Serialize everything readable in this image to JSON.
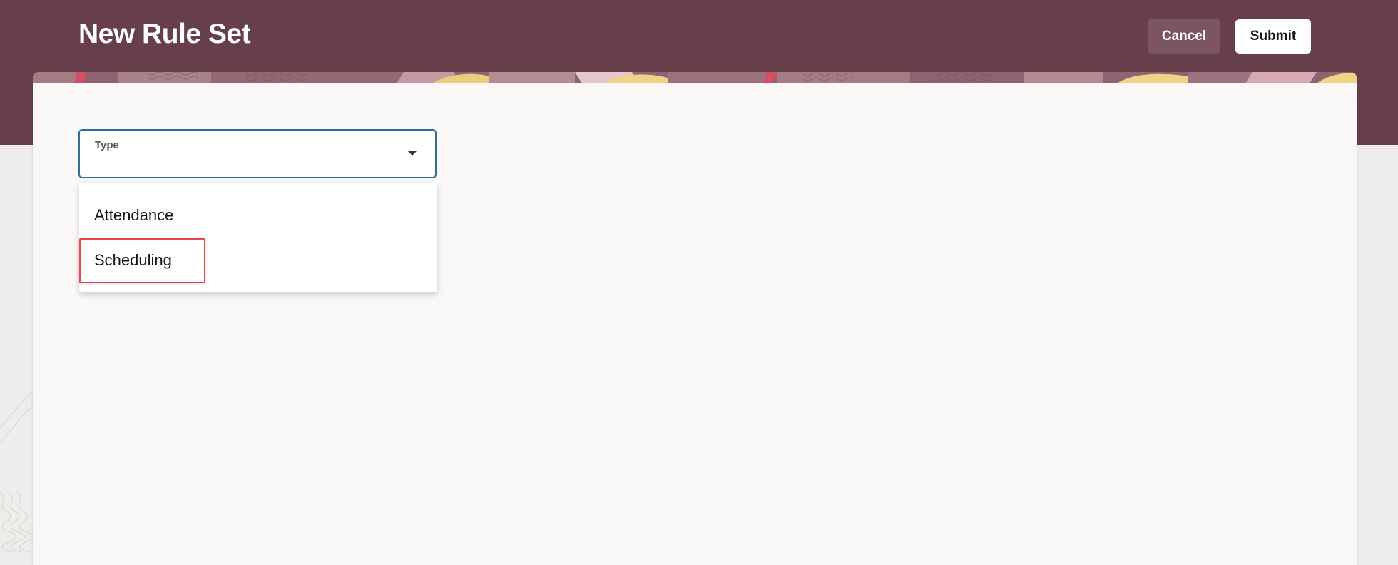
{
  "header": {
    "title": "New Rule Set",
    "cancel_label": "Cancel",
    "submit_label": "Submit"
  },
  "form": {
    "type_field": {
      "label": "Type",
      "value": "",
      "options": [
        "Attendance",
        "Scheduling"
      ],
      "highlighted_option": "Scheduling"
    }
  },
  "colors": {
    "header_background": "#663f4a",
    "cancel_button": "#7b5560",
    "field_border": "#2f6f93",
    "highlight_border": "#e5484d"
  },
  "icons": {
    "dropdown": "chevron-down-icon"
  }
}
